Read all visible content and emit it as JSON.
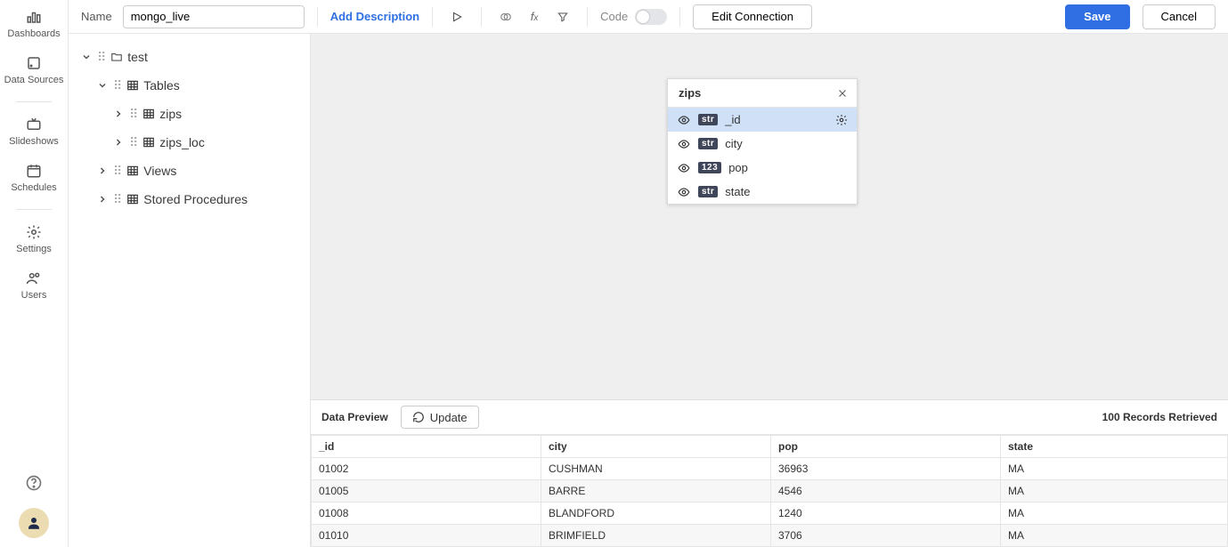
{
  "nav": {
    "items": [
      {
        "label": "Dashboards"
      },
      {
        "label": "Data Sources"
      },
      {
        "label": "Slideshows"
      },
      {
        "label": "Schedules"
      },
      {
        "label": "Settings"
      },
      {
        "label": "Users"
      }
    ]
  },
  "topbar": {
    "name_label": "Name",
    "name_value": "mongo_live",
    "add_description": "Add Description",
    "code_label": "Code",
    "edit_connection": "Edit Connection",
    "save": "Save",
    "cancel": "Cancel"
  },
  "tree": {
    "root": "test",
    "groups": [
      {
        "label": "Tables",
        "children": [
          {
            "label": "zips"
          },
          {
            "label": "zips_loc"
          }
        ]
      },
      {
        "label": "Views",
        "children": []
      },
      {
        "label": "Stored Procedures",
        "children": []
      }
    ]
  },
  "popup": {
    "title": "zips",
    "fields": [
      {
        "name": "_id",
        "type": "str",
        "selected": true
      },
      {
        "name": "city",
        "type": "str",
        "selected": false
      },
      {
        "name": "pop",
        "type": "123",
        "selected": false
      },
      {
        "name": "state",
        "type": "str",
        "selected": false
      }
    ]
  },
  "preview": {
    "title": "Data Preview",
    "update": "Update",
    "count": "100 Records Retrieved",
    "columns": [
      "_id",
      "city",
      "pop",
      "state"
    ],
    "rows": [
      {
        "_id": "01002",
        "city": "CUSHMAN",
        "pop": "36963",
        "state": "MA"
      },
      {
        "_id": "01005",
        "city": "BARRE",
        "pop": "4546",
        "state": "MA"
      },
      {
        "_id": "01008",
        "city": "BLANDFORD",
        "pop": "1240",
        "state": "MA"
      },
      {
        "_id": "01010",
        "city": "BRIMFIELD",
        "pop": "3706",
        "state": "MA"
      }
    ]
  }
}
